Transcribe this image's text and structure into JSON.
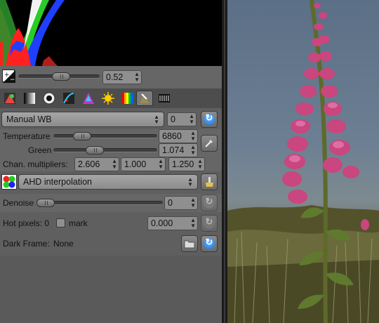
{
  "exposure": {
    "value": "0.52"
  },
  "white_balance": {
    "mode": "Manual WB",
    "mode_spin": "0",
    "temperature_label": "Temperature",
    "temperature_value": "6860",
    "green_label": "Green",
    "green_value": "1.074",
    "chan_label": "Chan. multipliers:",
    "chan_values": [
      "2.606",
      "1.000",
      "1.250"
    ]
  },
  "interpolation": {
    "value": "AHD interpolation"
  },
  "denoise": {
    "label": "Denoise",
    "value": "0"
  },
  "hot_pixels": {
    "label": "Hot pixels: 0",
    "mark_label": "mark",
    "value": "0.000"
  },
  "dark_frame": {
    "label": "Dark Frame:",
    "value": "None"
  },
  "tabs": [
    "raw-icon",
    "grayscale-icon",
    "lens-icon",
    "curves-icon",
    "color-icon",
    "light-icon",
    "spectrum-icon",
    "zoom-icon",
    "film-icon"
  ],
  "toolbar_icons": [
    "bulb-icon",
    "tint-icon",
    "gears-icon",
    "refresh-icon"
  ],
  "colors": {
    "accent_blue": "#2a7bd8",
    "panel_bg": "#5f5f5f",
    "divider": "#1b1b1b"
  }
}
